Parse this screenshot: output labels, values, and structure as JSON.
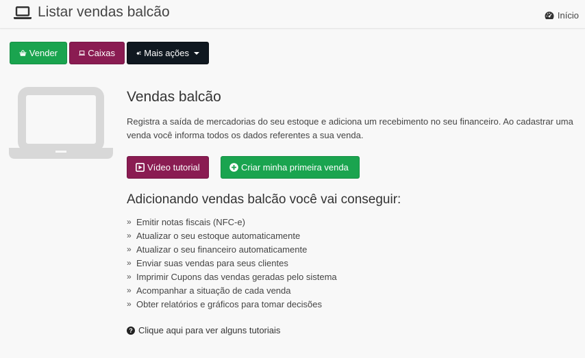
{
  "header": {
    "title": "Listar vendas balcão",
    "home_label": "Início"
  },
  "toolbar": {
    "sell_label": "Vender",
    "cash_label": "Caixas",
    "more_label": "Mais ações"
  },
  "main": {
    "title": "Vendas balcão",
    "description": "Registra a saída de mercadorias do seu estoque e adiciona um recebimento no seu financeiro. Ao cadastrar uma venda você informa todos os dados referentes a sua venda.",
    "video_label": "Vídeo tutorial",
    "create_label": "Criar minha primeira venda",
    "benefits_title": "Adicionando vendas balcão você vai conseguir:",
    "benefits": [
      "Emitir notas fiscais (NFC-e)",
      "Atualizar o seu estoque automaticamente",
      "Atualizar o seu financeiro automaticamente",
      "Enviar suas vendas para seus clientes",
      "Imprimir Cupons das vendas geradas pelo sistema",
      "Acompanhar a situação de cada venda",
      "Obter relatórios e gráficos para tomar decisões"
    ],
    "help_label": "Clique aqui para ver alguns tutoriais"
  },
  "icons": {
    "title": "laptop-icon",
    "home": "dashboard-icon",
    "sell": "basket-icon",
    "cash": "laptop-icon",
    "more": "gears-icon",
    "video": "play-square-icon",
    "create": "plus-circle-icon",
    "benefit": "double-chevron-right-icon",
    "help": "question-circle-icon"
  },
  "colors": {
    "green": "#1aa44f",
    "purple": "#8a1c52",
    "dark": "#101820",
    "illustration": "#d8d8d8"
  }
}
